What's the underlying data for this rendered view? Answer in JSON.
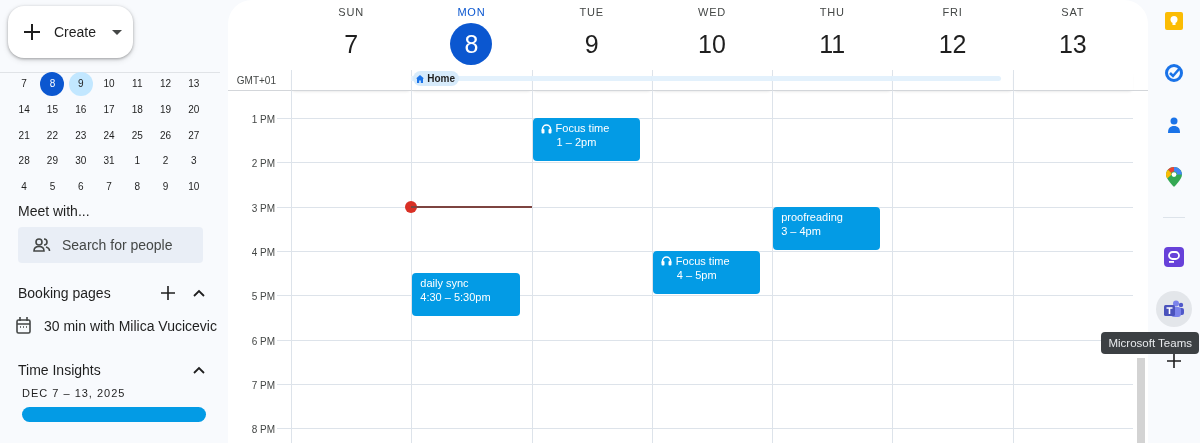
{
  "sidebar": {
    "create_button": {
      "label": "Create"
    },
    "mini_calendar": {
      "weeks": [
        [
          {
            "day": "7",
            "today": false,
            "selected": false
          },
          {
            "day": "8",
            "today": true,
            "selected": false
          },
          {
            "day": "9",
            "today": false,
            "selected": true
          },
          {
            "day": "10",
            "today": false,
            "selected": false
          },
          {
            "day": "11",
            "today": false,
            "selected": false
          },
          {
            "day": "12",
            "today": false,
            "selected": false
          },
          {
            "day": "13",
            "today": false,
            "selected": false
          }
        ],
        [
          {
            "day": "14",
            "today": false,
            "selected": false
          },
          {
            "day": "15",
            "today": false,
            "selected": false
          },
          {
            "day": "16",
            "today": false,
            "selected": false
          },
          {
            "day": "17",
            "today": false,
            "selected": false
          },
          {
            "day": "18",
            "today": false,
            "selected": false
          },
          {
            "day": "19",
            "today": false,
            "selected": false
          },
          {
            "day": "20",
            "today": false,
            "selected": false
          }
        ],
        [
          {
            "day": "21",
            "today": false,
            "selected": false
          },
          {
            "day": "22",
            "today": false,
            "selected": false
          },
          {
            "day": "23",
            "today": false,
            "selected": false
          },
          {
            "day": "24",
            "today": false,
            "selected": false
          },
          {
            "day": "25",
            "today": false,
            "selected": false
          },
          {
            "day": "26",
            "today": false,
            "selected": false
          },
          {
            "day": "27",
            "today": false,
            "selected": false
          }
        ],
        [
          {
            "day": "28",
            "today": false,
            "selected": false
          },
          {
            "day": "29",
            "today": false,
            "selected": false
          },
          {
            "day": "30",
            "today": false,
            "selected": false
          },
          {
            "day": "31",
            "today": false,
            "selected": false
          },
          {
            "day": "1",
            "today": false,
            "selected": false
          },
          {
            "day": "2",
            "today": false,
            "selected": false
          },
          {
            "day": "3",
            "today": false,
            "selected": false
          }
        ],
        [
          {
            "day": "4",
            "today": false,
            "selected": false
          },
          {
            "day": "5",
            "today": false,
            "selected": false
          },
          {
            "day": "6",
            "today": false,
            "selected": false
          },
          {
            "day": "7",
            "today": false,
            "selected": false
          },
          {
            "day": "8",
            "today": false,
            "selected": false
          },
          {
            "day": "9",
            "today": false,
            "selected": false
          },
          {
            "day": "10",
            "today": false,
            "selected": false
          }
        ]
      ]
    },
    "meet_with": {
      "title": "Meet with...",
      "placeholder": "Search for people"
    },
    "booking_pages": {
      "title": "Booking pages",
      "expanded": true,
      "items": [
        "30 min with Milica Vucicevic"
      ]
    },
    "time_insights": {
      "title": "Time Insights",
      "expanded": true,
      "range": "DEC 7 – 13, 2025"
    }
  },
  "calendar": {
    "timezone": "GMT+01",
    "working_location": "Home",
    "hours": [
      {
        "label": "1 PM",
        "now": false
      },
      {
        "label": "2 PM",
        "now": false
      },
      {
        "label": "3 PM",
        "now": true
      },
      {
        "label": "4 PM",
        "now": false
      },
      {
        "label": "5 PM",
        "now": false
      },
      {
        "label": "6 PM",
        "now": false
      },
      {
        "label": "7 PM",
        "now": false
      },
      {
        "label": "8 PM",
        "now": false
      }
    ],
    "days": [
      {
        "name": "SUN",
        "date": "7",
        "today": false,
        "working_location": false
      },
      {
        "name": "MON",
        "date": "8",
        "today": true,
        "working_location": true,
        "events": [
          {
            "kind": "event",
            "title": "daily sync",
            "time": "4:30 – 5:30pm"
          }
        ]
      },
      {
        "name": "TUE",
        "date": "9",
        "today": false,
        "working_location": true,
        "events": [
          {
            "kind": "focus",
            "title": "Focus time",
            "time": "1 – 2pm"
          }
        ]
      },
      {
        "name": "WED",
        "date": "10",
        "today": false,
        "working_location": true,
        "events": [
          {
            "kind": "focus",
            "title": "Focus time",
            "time": "4 – 5pm"
          }
        ]
      },
      {
        "name": "THU",
        "date": "11",
        "today": false,
        "working_location": true,
        "events": [
          {
            "kind": "event",
            "title": "proofreading",
            "time": "3 – 4pm"
          }
        ]
      },
      {
        "name": "FRI",
        "date": "12",
        "today": false,
        "working_location": true
      },
      {
        "name": "SAT",
        "date": "13",
        "today": false,
        "working_location": false
      }
    ]
  },
  "rail": {
    "tooltip": "Microsoft Teams",
    "items": [
      {
        "kind": "keep",
        "hovered": false
      },
      {
        "kind": "tasks",
        "hovered": false
      },
      {
        "kind": "contacts",
        "hovered": false
      },
      {
        "kind": "maps",
        "hovered": false
      },
      {
        "kind": "divider"
      },
      {
        "kind": "notes",
        "hovered": false
      },
      {
        "kind": "teams",
        "hovered": true
      },
      {
        "kind": "add",
        "hovered": false
      }
    ]
  }
}
